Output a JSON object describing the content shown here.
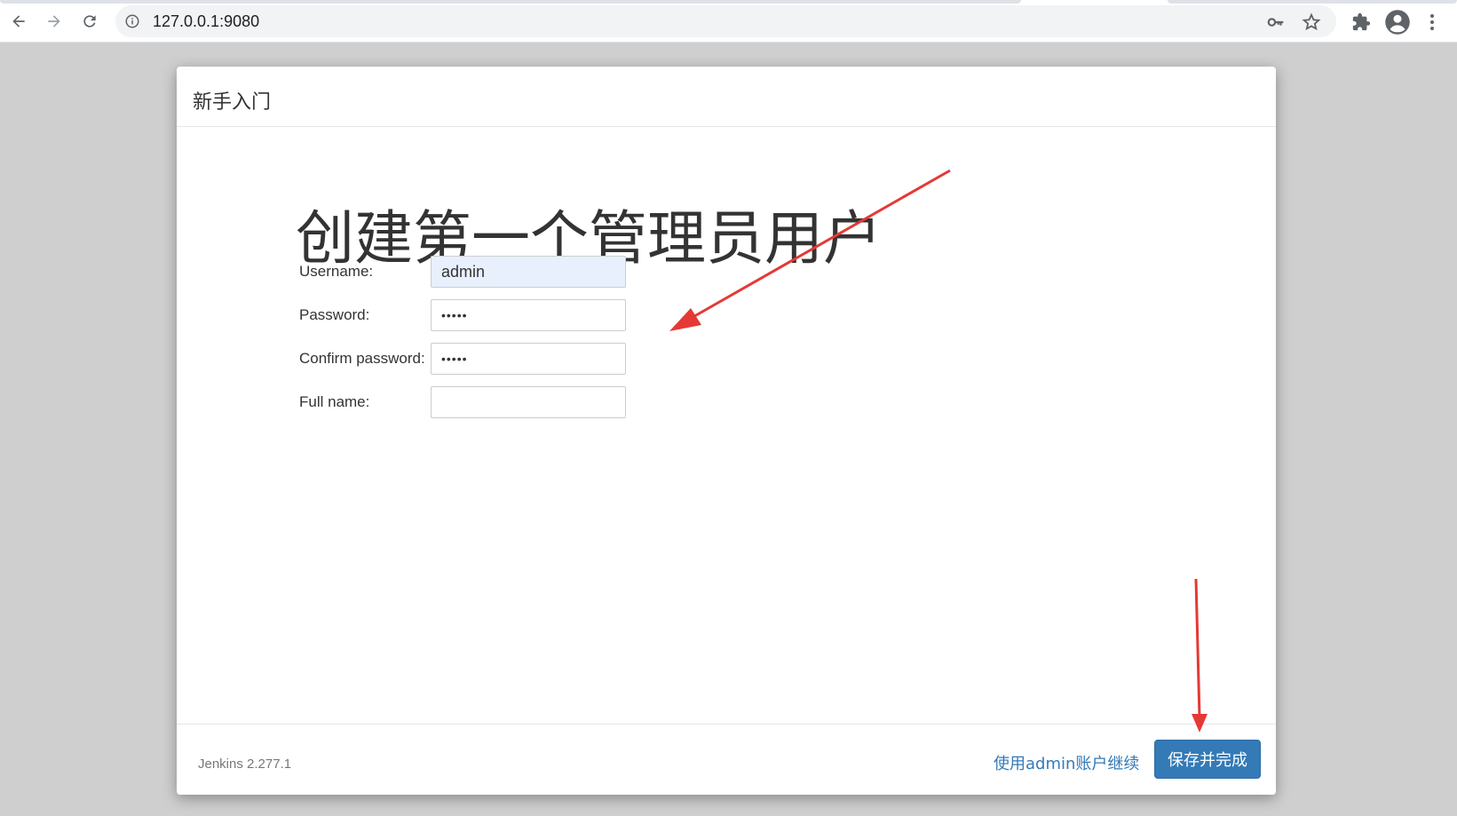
{
  "browser": {
    "url": "127.0.0.1:9080",
    "icons": [
      "back-icon",
      "forward-icon",
      "reload-icon",
      "site-info-icon",
      "password-key-icon",
      "bookmark-star-icon",
      "extensions-puzzle-icon",
      "profile-avatar-icon",
      "menu-kebab-icon"
    ]
  },
  "dialog": {
    "title": "新手入门",
    "heading": "创建第一个管理员用户",
    "form": {
      "username_label": "Username:",
      "username_value": "admin",
      "password_label": "Password:",
      "password_value": "•••••",
      "confirm_label": "Confirm password:",
      "confirm_value": "•••••",
      "fullname_label": "Full name:",
      "fullname_value": ""
    },
    "footer": {
      "version": "Jenkins 2.277.1",
      "skip_link": "使用admin账户继续",
      "save_button": "保存并完成"
    }
  },
  "colors": {
    "primary": "#337ab7",
    "autofill": "#e8f0fe",
    "annotation_arrow": "#e53935"
  }
}
